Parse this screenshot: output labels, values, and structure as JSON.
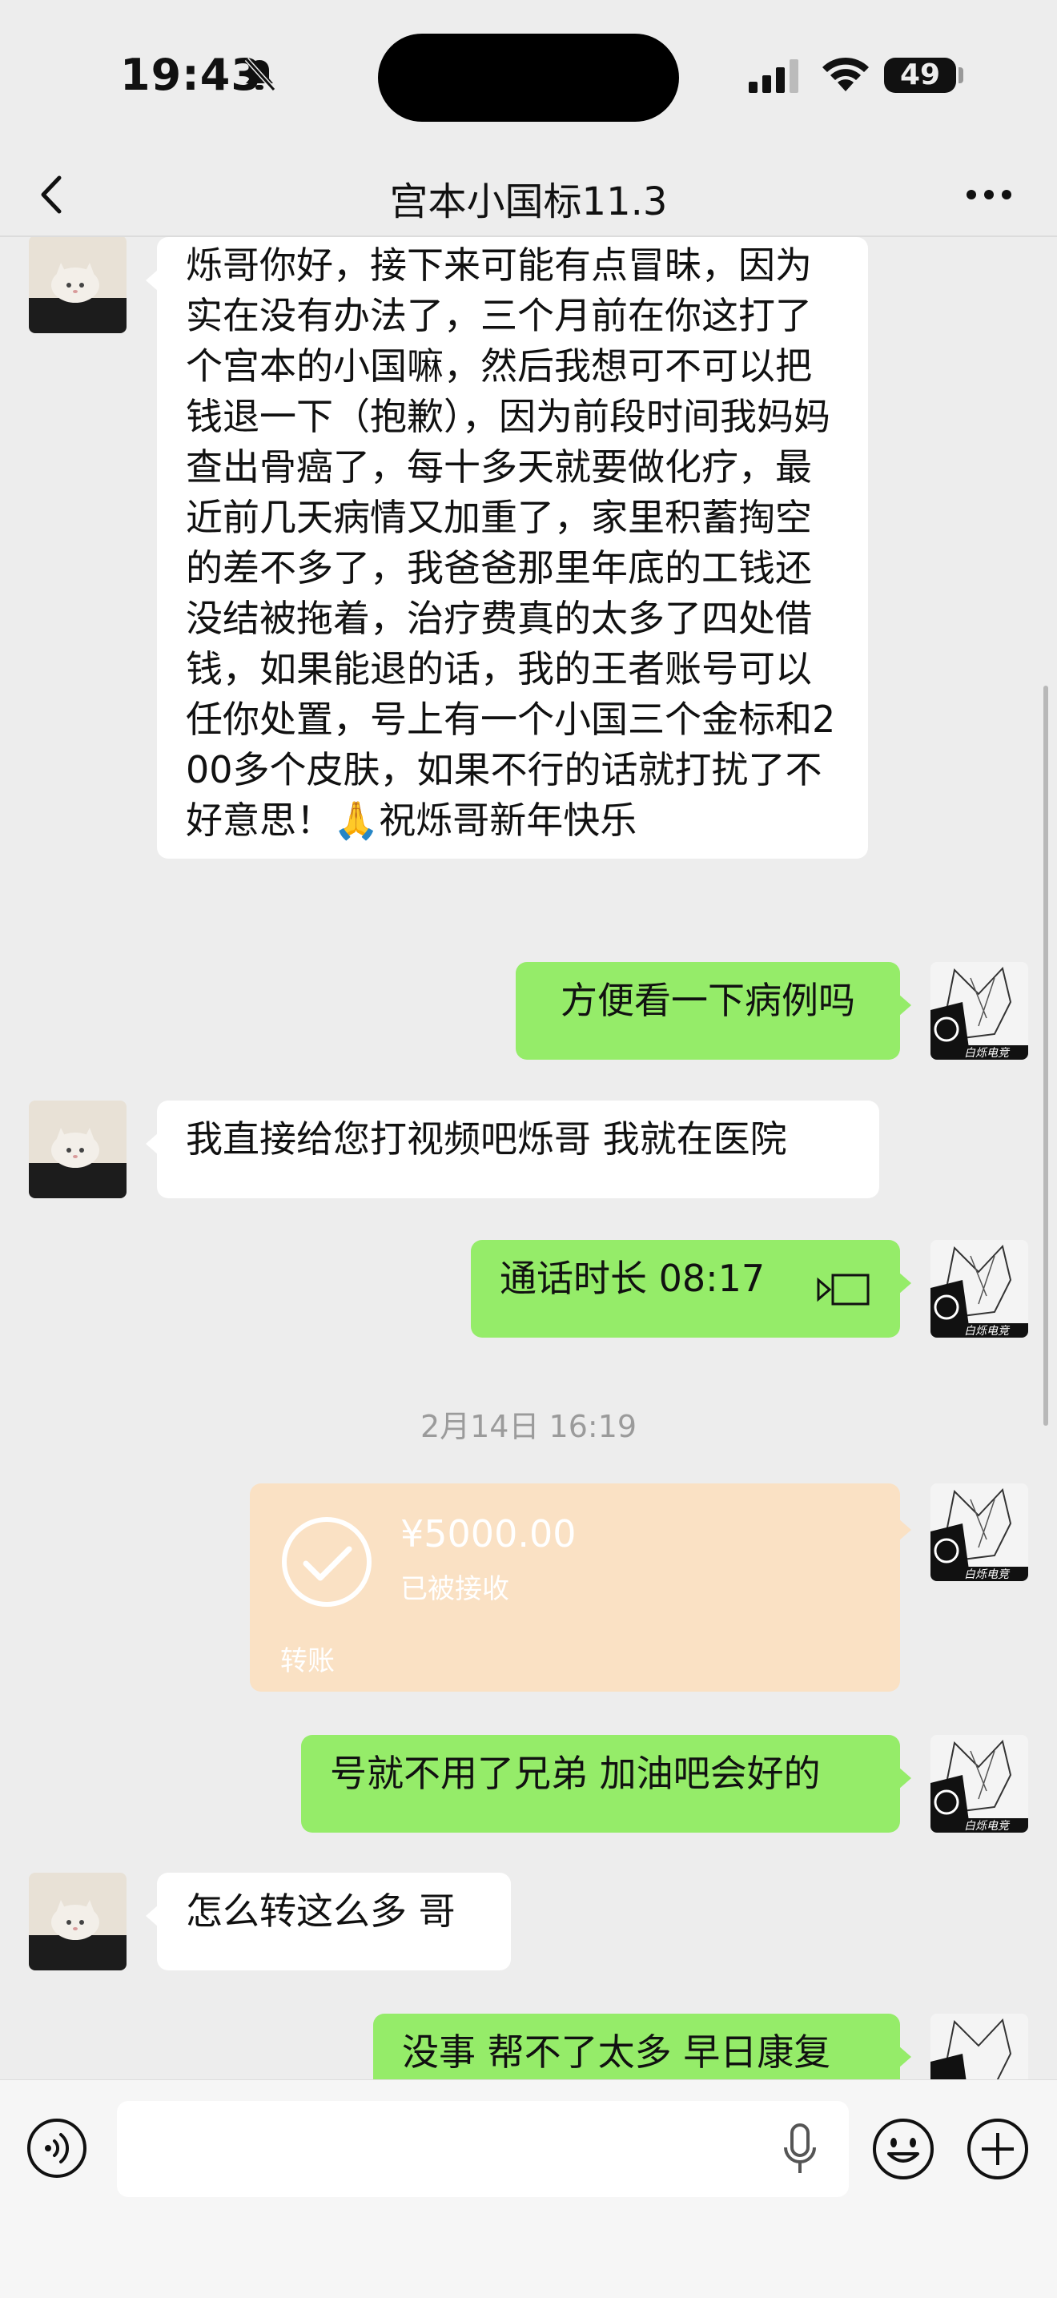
{
  "status_bar": {
    "time": "19:43",
    "battery": "49"
  },
  "header": {
    "title": "宫本小国标11.3"
  },
  "messages": {
    "m1_text": "烁哥你好，接下来可能有点冒昧，因为实在没有办法了，三个月前在你这打了个宫本的小国嘛，然后我想可不可以把钱退一下（抱歉），因为前段时间我妈妈查出骨癌了，每十多天就要做化疗，最近前几天病情又加重了，家里积蓄掏空的差不多了，我爸爸那里年底的工钱还没结被拖着，治疗费真的太多了四处借钱，如果能退的话，我的王者账号可以任你处置，号上有一个小国三个金标和200多个皮肤，如果不行的话就打扰了不好意思！🙏祝烁哥新年快乐",
    "m2_text": "方便看一下病例吗",
    "m3_text": "我直接给您打视频吧烁哥 我就在医院",
    "m4_text": "通话时长 08:17",
    "timestamp": "2月14日 16:19",
    "transfer": {
      "amount": "¥5000.00",
      "status": "已被接收",
      "label": "转账"
    },
    "m6_text": "号就不用了兄弟 加油吧会好的",
    "m7_text": "怎么转这么多 哥",
    "m8_text": "没事 帮不了太多 早日康复"
  },
  "avatar_badge": "白烁电竞",
  "colors": {
    "outgoing": "#95ec69",
    "incoming": "#ffffff",
    "transfer": "#fae1c4",
    "background": "#ededed"
  }
}
